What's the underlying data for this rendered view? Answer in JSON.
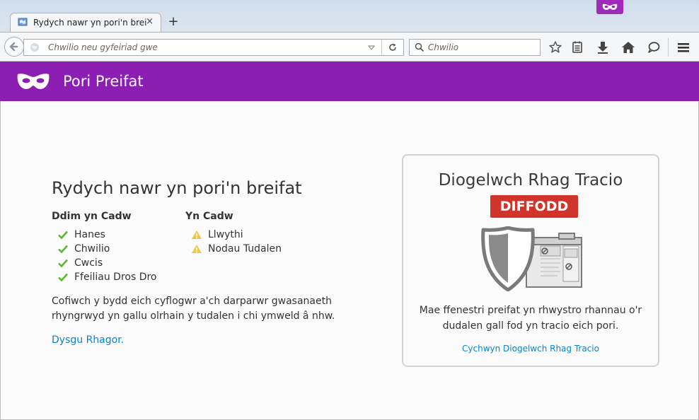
{
  "browser": {
    "tab": {
      "title": "Rydych nawr yn pori'n brei...",
      "close_label": "×"
    },
    "new_tab_label": "+",
    "url_bar": {
      "placeholder": "Chwilio neu gyfeiriad gwe",
      "value": ""
    },
    "search_bar": {
      "placeholder": "Chwilio",
      "value": ""
    },
    "toolbar_icons": [
      "bookmark-star-icon",
      "reading-list-icon",
      "download-icon",
      "home-icon",
      "chat-bubble-icon",
      "hamburger-menu-icon"
    ]
  },
  "header": {
    "title": "Pori Preifat",
    "icon": "private-mask-icon"
  },
  "main": {
    "heading": "Rydych nawr yn pori'n breifat",
    "not_saved": {
      "heading": "Ddim yn Cadw",
      "items": [
        "Hanes",
        "Chwilio",
        "Cwcis",
        "Ffeiliau Dros Dro"
      ]
    },
    "saved": {
      "heading": "Yn Cadw",
      "items": [
        "Llwythi",
        "Nodau Tudalen"
      ]
    },
    "note": "Cofiwch y bydd eich cyflogwr a'ch darparwr gwasanaeth rhyngrwyd yn gallu olrhain y tudalen i chi ymweld â nhw.",
    "learn_more": "Dysgu Rhagor."
  },
  "tracking_protection": {
    "title": "Diogelwch Rhag Tracio",
    "status": "DIFFODD",
    "description": "Mae ffenestri preifat yn rhwystro rhannau o'r dudalen gall fod yn tracio eich pori.",
    "link": "Cychwyn Diogelwch Rhag Tracio"
  },
  "colors": {
    "header_purple": "#8d1eb3",
    "status_red": "#d1342a",
    "link_blue": "#0a84c8",
    "check_green": "#5bb82f",
    "warning_yellow": "#f4c542"
  }
}
